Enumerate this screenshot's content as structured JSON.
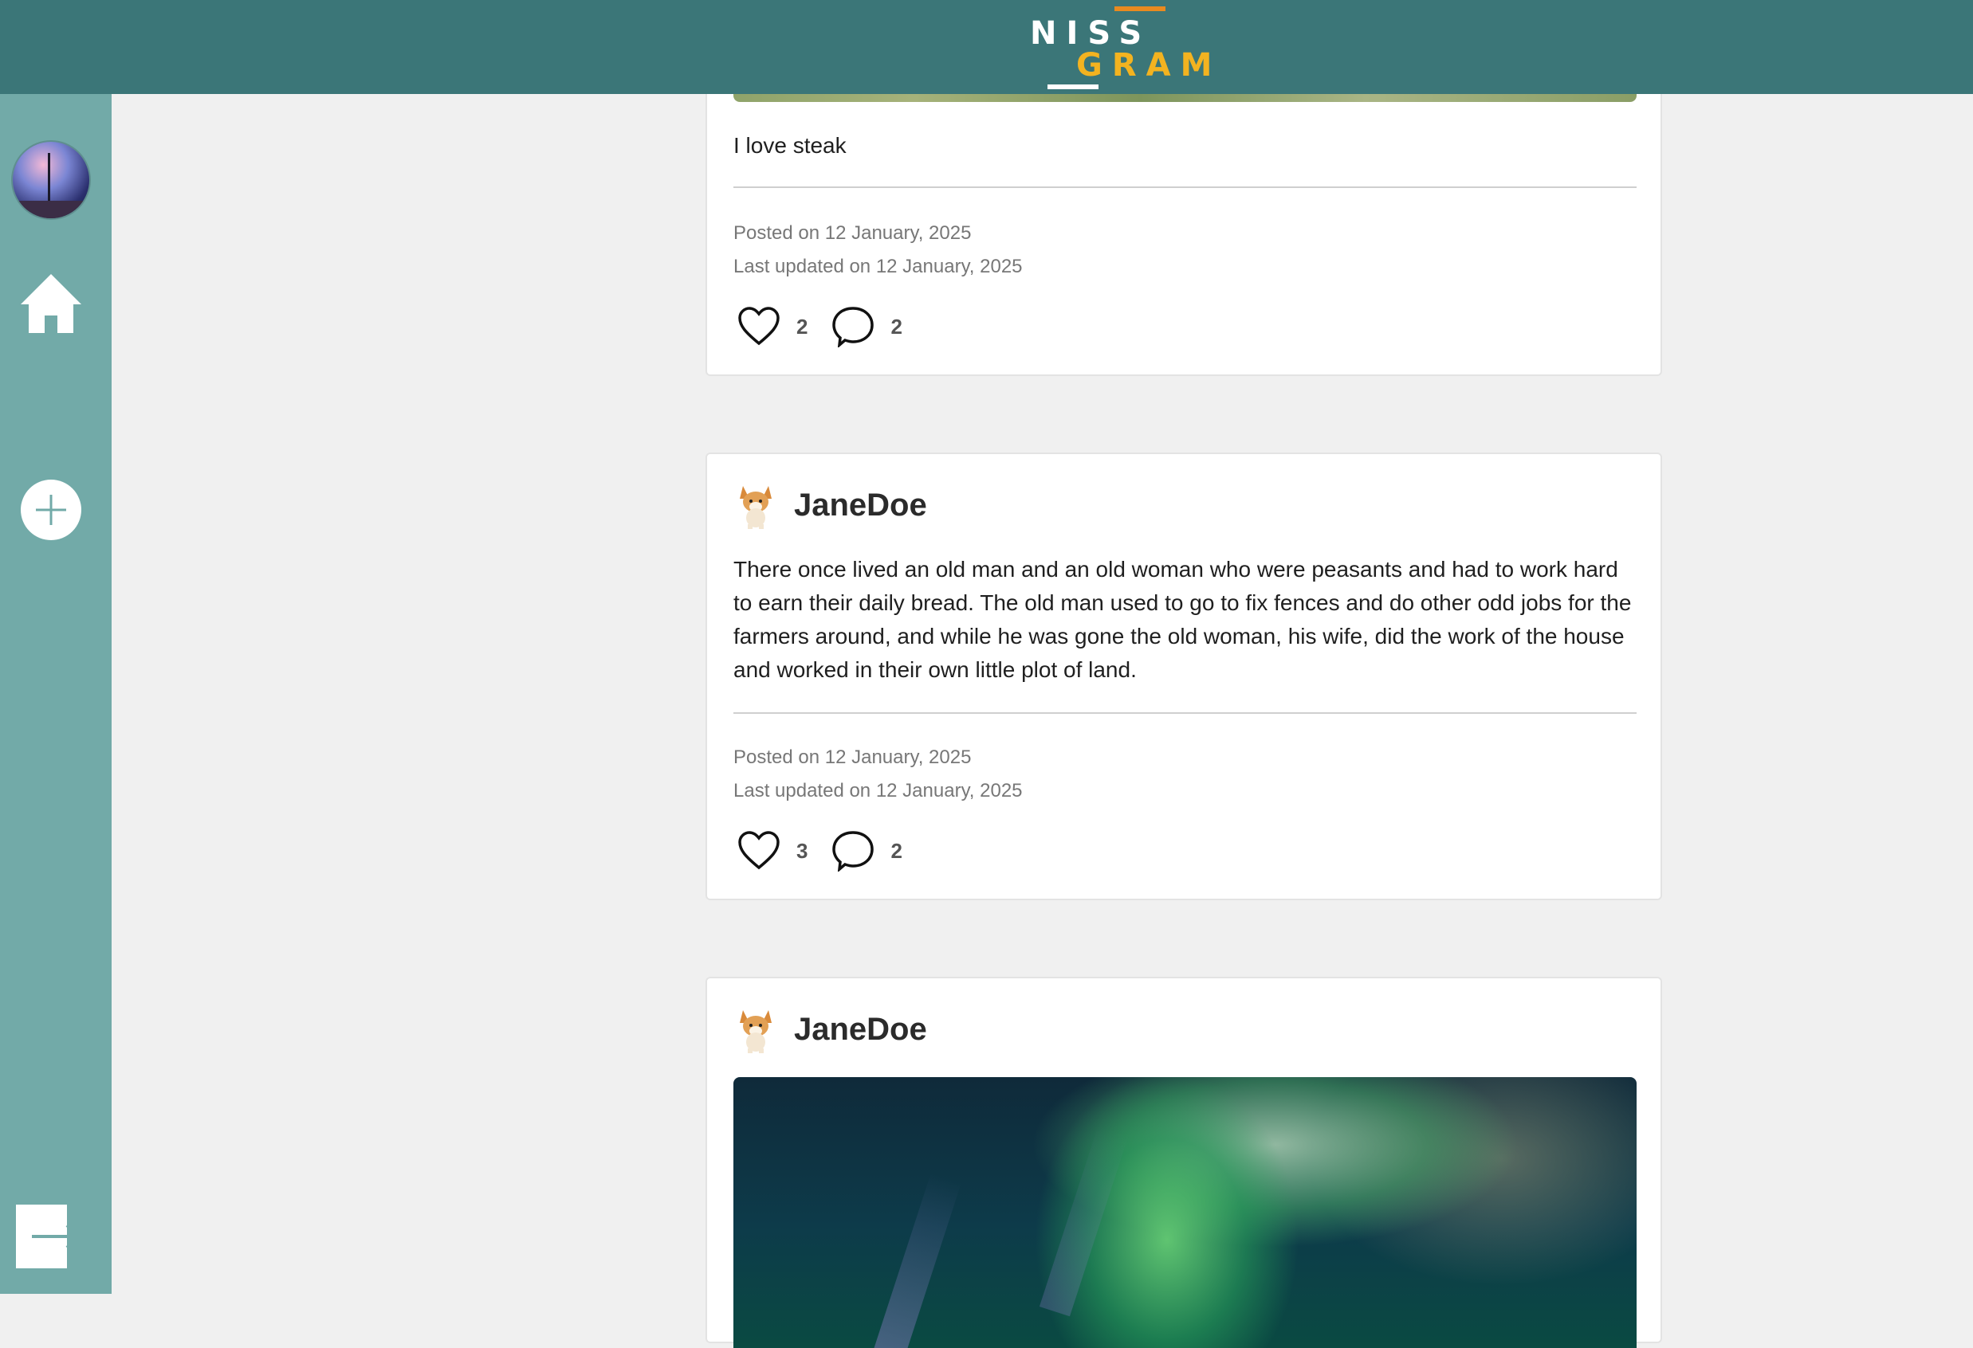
{
  "app": {
    "logo_top": "NISS",
    "logo_bottom": "GRAM"
  },
  "sidebar": {
    "profile_avatar": "profile-avatar",
    "home_icon": "home-icon",
    "add_icon": "plus-icon",
    "logout_icon": "logout-icon"
  },
  "posts": [
    {
      "caption": "I love steak",
      "posted": "Posted on 12 January, 2025",
      "updated": "Last updated on 12 January, 2025",
      "likes": "2",
      "comments": "2"
    },
    {
      "author": "JaneDoe",
      "text": "There once lived an old man and an old woman who were peasants and had to work hard to earn their daily bread. The old man used to go to fix fences and do other odd jobs for the farmers around, and while he was gone the old woman, his wife, did the work of the house and worked in their own little plot of land.",
      "posted": "Posted on 12 January, 2025",
      "updated": "Last updated on 12 January, 2025",
      "likes": "3",
      "comments": "2"
    },
    {
      "author": "JaneDoe"
    }
  ],
  "colors": {
    "header": "#3b7678",
    "sidebar": "#72aaa8",
    "logo_accent": "#f3b320",
    "logo_bar": "#e98a1f"
  }
}
